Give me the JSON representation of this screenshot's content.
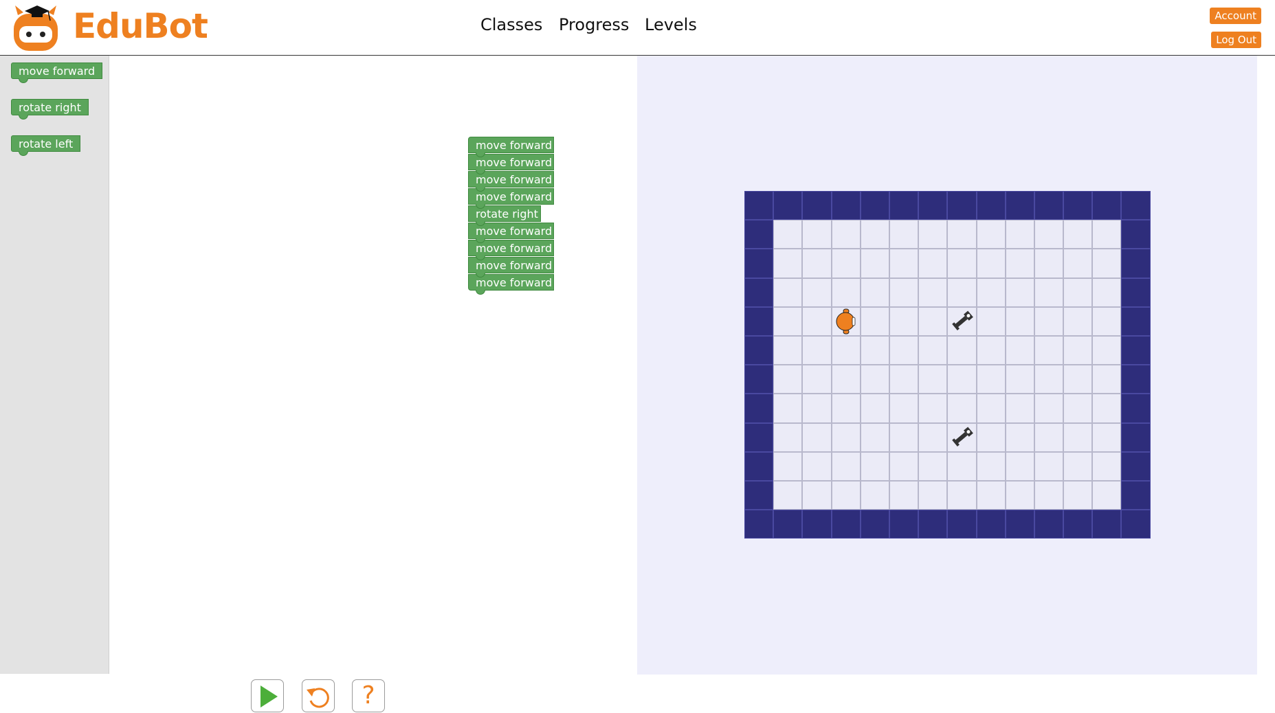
{
  "app": {
    "brand": "EduBot"
  },
  "nav": {
    "classes": "Classes",
    "progress": "Progress",
    "levels": "Levels"
  },
  "account": {
    "account_label": "Account",
    "logout_label": "Log Out"
  },
  "toolbox": {
    "blocks": [
      "move forward",
      "rotate right",
      "rotate left"
    ]
  },
  "program": {
    "blocks": [
      "move forward",
      "move forward",
      "move forward",
      "move forward",
      "rotate right",
      "move forward",
      "move forward",
      "move forward",
      "move forward"
    ]
  },
  "stage": {
    "grid_columns": 14,
    "grid_rows": 12,
    "robot": {
      "col": 3,
      "row": 4,
      "facing": "right"
    },
    "tools": [
      {
        "col": 7,
        "row": 4
      },
      {
        "col": 7,
        "row": 8
      }
    ]
  },
  "controls": {
    "run": "run-icon",
    "reset": "reset-icon",
    "help_label": "?"
  },
  "colors": {
    "accent": "#ee8020",
    "block": "#5ba55b",
    "wall": "#2e2d7b",
    "stage_bg": "#eeeefb"
  }
}
